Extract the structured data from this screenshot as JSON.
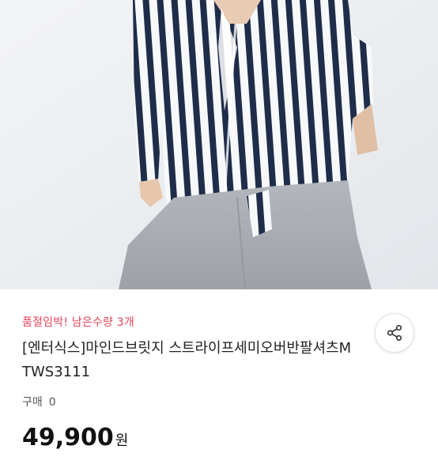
{
  "product": {
    "stock_notice": "품절임박! 남은수량 3개",
    "title": "[엔터식스]마인드브릿지 스트라이프세미오버반팔셔츠MTWS3111",
    "purchase_label": "구매",
    "purchase_count": "0",
    "price": "49,900",
    "price_unit": "원"
  },
  "icons": {
    "share": "share-icon"
  },
  "colors": {
    "stock_notice": "#e8445a",
    "title": "#222222",
    "stripe_navy": "#1f2d4a",
    "pants_gray": "#a9adb3"
  }
}
